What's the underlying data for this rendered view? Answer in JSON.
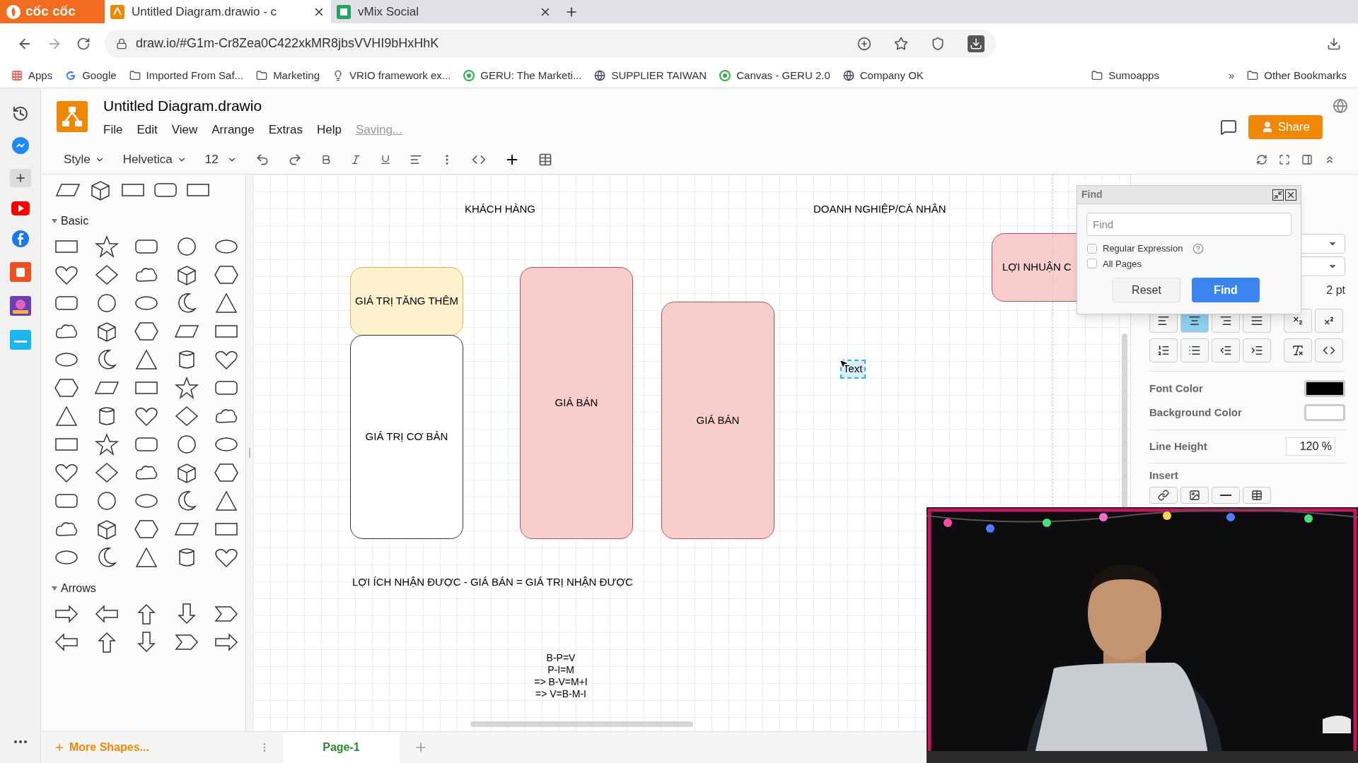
{
  "browser": {
    "brand": "cốc cốc",
    "tabs": [
      {
        "label": "Untitled Diagram.drawio - c",
        "selected": true
      },
      {
        "label": "vMix Social",
        "selected": false
      }
    ],
    "address": "draw.io/#G1m-Cr8Zea0C422xkMR8jbsVVHI9bHxHhK",
    "bookmarks": [
      {
        "label": "Apps",
        "kind": "apps"
      },
      {
        "label": "Google",
        "kind": "google"
      },
      {
        "label": "Imported From Saf...",
        "kind": "folder"
      },
      {
        "label": "Marketing",
        "kind": "folder"
      },
      {
        "label": "VRIO framework ex...",
        "kind": "bulb"
      },
      {
        "label": "GERU: The Marketi...",
        "kind": "geru"
      },
      {
        "label": "SUPPLIER TAIWAN",
        "kind": "globe"
      },
      {
        "label": "Canvas - GERU 2.0",
        "kind": "geru"
      },
      {
        "label": "Company OK",
        "kind": "globe"
      }
    ],
    "bookmarks_right": [
      {
        "label": "Sumoapps",
        "kind": "folder"
      },
      {
        "label": "»",
        "kind": "overflow"
      },
      {
        "label": "Other Bookmarks",
        "kind": "folder"
      }
    ]
  },
  "app": {
    "title": "Untitled Diagram.drawio",
    "menu": [
      "File",
      "Edit",
      "View",
      "Arrange",
      "Extras",
      "Help"
    ],
    "status": "Saving...",
    "share": "Share"
  },
  "toolbar": {
    "style": "Style",
    "font": "Helvetica",
    "size": "12"
  },
  "shapes_panel": {
    "sections": [
      {
        "title": "Basic",
        "expanded": true
      },
      {
        "title": "Arrows",
        "expanded": true
      }
    ],
    "more": "More Shapes..."
  },
  "canvas": {
    "nodes": [
      {
        "kind": "label",
        "text": "KHÁCH HÀNG",
        "selected": false
      },
      {
        "kind": "label",
        "text": "DOANH NGHIỆP/CÁ NHÂN",
        "selected": false
      },
      {
        "kind": "box",
        "text": "GIÁ TRỊ TĂNG THÊM",
        "color": "#fff2cc",
        "selected": false
      },
      {
        "kind": "box",
        "text": "GIÁ TRỊ CƠ BẢN",
        "color": "#ffffff",
        "selected": false
      },
      {
        "kind": "box",
        "text": "GIÁ BÁN",
        "color": "#f8cecc",
        "selected": false
      },
      {
        "kind": "box",
        "text": "GIÁ BÁN",
        "color": "#f8cecc",
        "selected": false
      },
      {
        "kind": "box",
        "text": "LỢI NHUẬN C",
        "color": "#f8cecc",
        "selected": false
      },
      {
        "kind": "label",
        "text": "Text",
        "selected": true
      },
      {
        "kind": "label",
        "text": "LỢI ÍCH NHẬN ĐƯỢC - GIÁ BÁN = GIÁ TRỊ NHẬN ĐƯỢC",
        "selected": false
      },
      {
        "kind": "lines",
        "lines": [
          "B-P=V",
          "P-I=M",
          "=> B-V=M+I",
          "=> V=B-M-I"
        ],
        "selected": false
      }
    ]
  },
  "find_dialog": {
    "title": "Find",
    "placeholder": "Find",
    "options": [
      {
        "label": "Regular Expression",
        "checked": false,
        "help": true
      },
      {
        "label": "All Pages",
        "checked": false,
        "help": false
      }
    ],
    "buttons": [
      {
        "label": "Reset",
        "kind": "secondary"
      },
      {
        "label": "Find",
        "kind": "primary"
      }
    ]
  },
  "format_panel": {
    "spacing": "2 pt",
    "alignment": [
      {
        "kind": "left",
        "selected": false
      },
      {
        "kind": "center",
        "selected": true
      },
      {
        "kind": "right",
        "selected": false
      },
      {
        "kind": "justify",
        "selected": false
      }
    ],
    "font_color": {
      "label": "Font Color",
      "color": "#000000"
    },
    "background_color": {
      "label": "Background Color",
      "color": "#ffffff"
    },
    "line_height": {
      "label": "Line Height",
      "value": "120 %"
    },
    "insert": {
      "label": "Insert"
    }
  },
  "pages": [
    {
      "label": "Page-1",
      "selected": true
    }
  ]
}
